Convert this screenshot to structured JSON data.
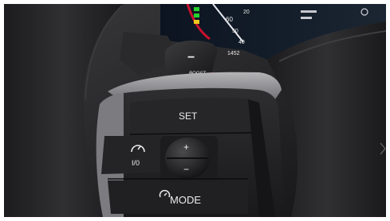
{
  "cluster": {
    "readouts": [
      "60",
      "20",
      "50",
      "40",
      "4",
      "1452"
    ]
  },
  "paddle": {
    "minus": "−",
    "boost": "BOOST"
  },
  "buttons": {
    "set": "SET",
    "limiter": "I/0",
    "plus": "+",
    "minus": "−",
    "mode": "MODE"
  },
  "icons": [
    "speed-limiter-icon",
    "mode-gauge-icon"
  ],
  "colors": {
    "interior": "#1e1e20",
    "steering_wheel": "#2c2c2e",
    "trim": "#8f8f92",
    "paddle_accent": "#d0231d",
    "display_red": "#c8102e",
    "display_green": "#27d12d"
  }
}
